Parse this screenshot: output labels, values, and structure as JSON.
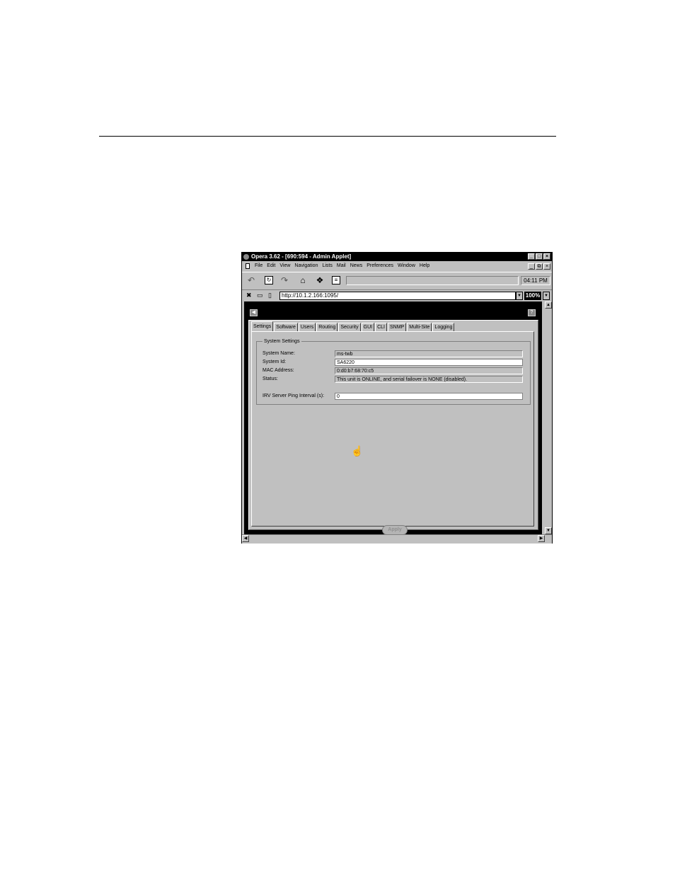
{
  "window": {
    "title": "Opera 3.62 - [690:594 - Admin Applet]",
    "controls": [
      "_",
      "□",
      "×"
    ]
  },
  "menubar": {
    "items": [
      "File",
      "Edit",
      "View",
      "Navigation",
      "Lists",
      "Mail",
      "News",
      "Preferences",
      "Window",
      "Help"
    ],
    "controls": [
      "_",
      "⧉",
      "×"
    ]
  },
  "toolbar": {
    "clock": "04:11 PM"
  },
  "address": {
    "url": "http://10.1.2.166:1095/",
    "zoom": "100%"
  },
  "tabs": [
    "Settings",
    "Software",
    "Users",
    "Routing",
    "Security",
    "GUI",
    "CLI",
    "SNMP",
    "Multi-Site",
    "Logging"
  ],
  "active_tab": "Settings",
  "system_settings": {
    "group_title": "System Settings",
    "name_label": "System Name:",
    "name_value": "ms-twb",
    "id_label": "System Id:",
    "id_value": "SA6220",
    "mac_label": "MAC Address:",
    "mac_value": "0:d0:b7:68:70:c5",
    "status_label": "Status:",
    "status_value": "This unit is ONLINE, and serial failover is NONE (disabled).",
    "ping_label": "IRV Server Ping Interval (s):",
    "ping_value": "0"
  },
  "apply_label": "Apply",
  "icons": {
    "back": "back-arrow-icon",
    "reload": "reload-icon",
    "forward": "forward-arrow-icon",
    "home": "home-icon",
    "hotlist": "hotlist-icon",
    "help": "help-icon",
    "cursor": "hand-cursor-icon"
  }
}
